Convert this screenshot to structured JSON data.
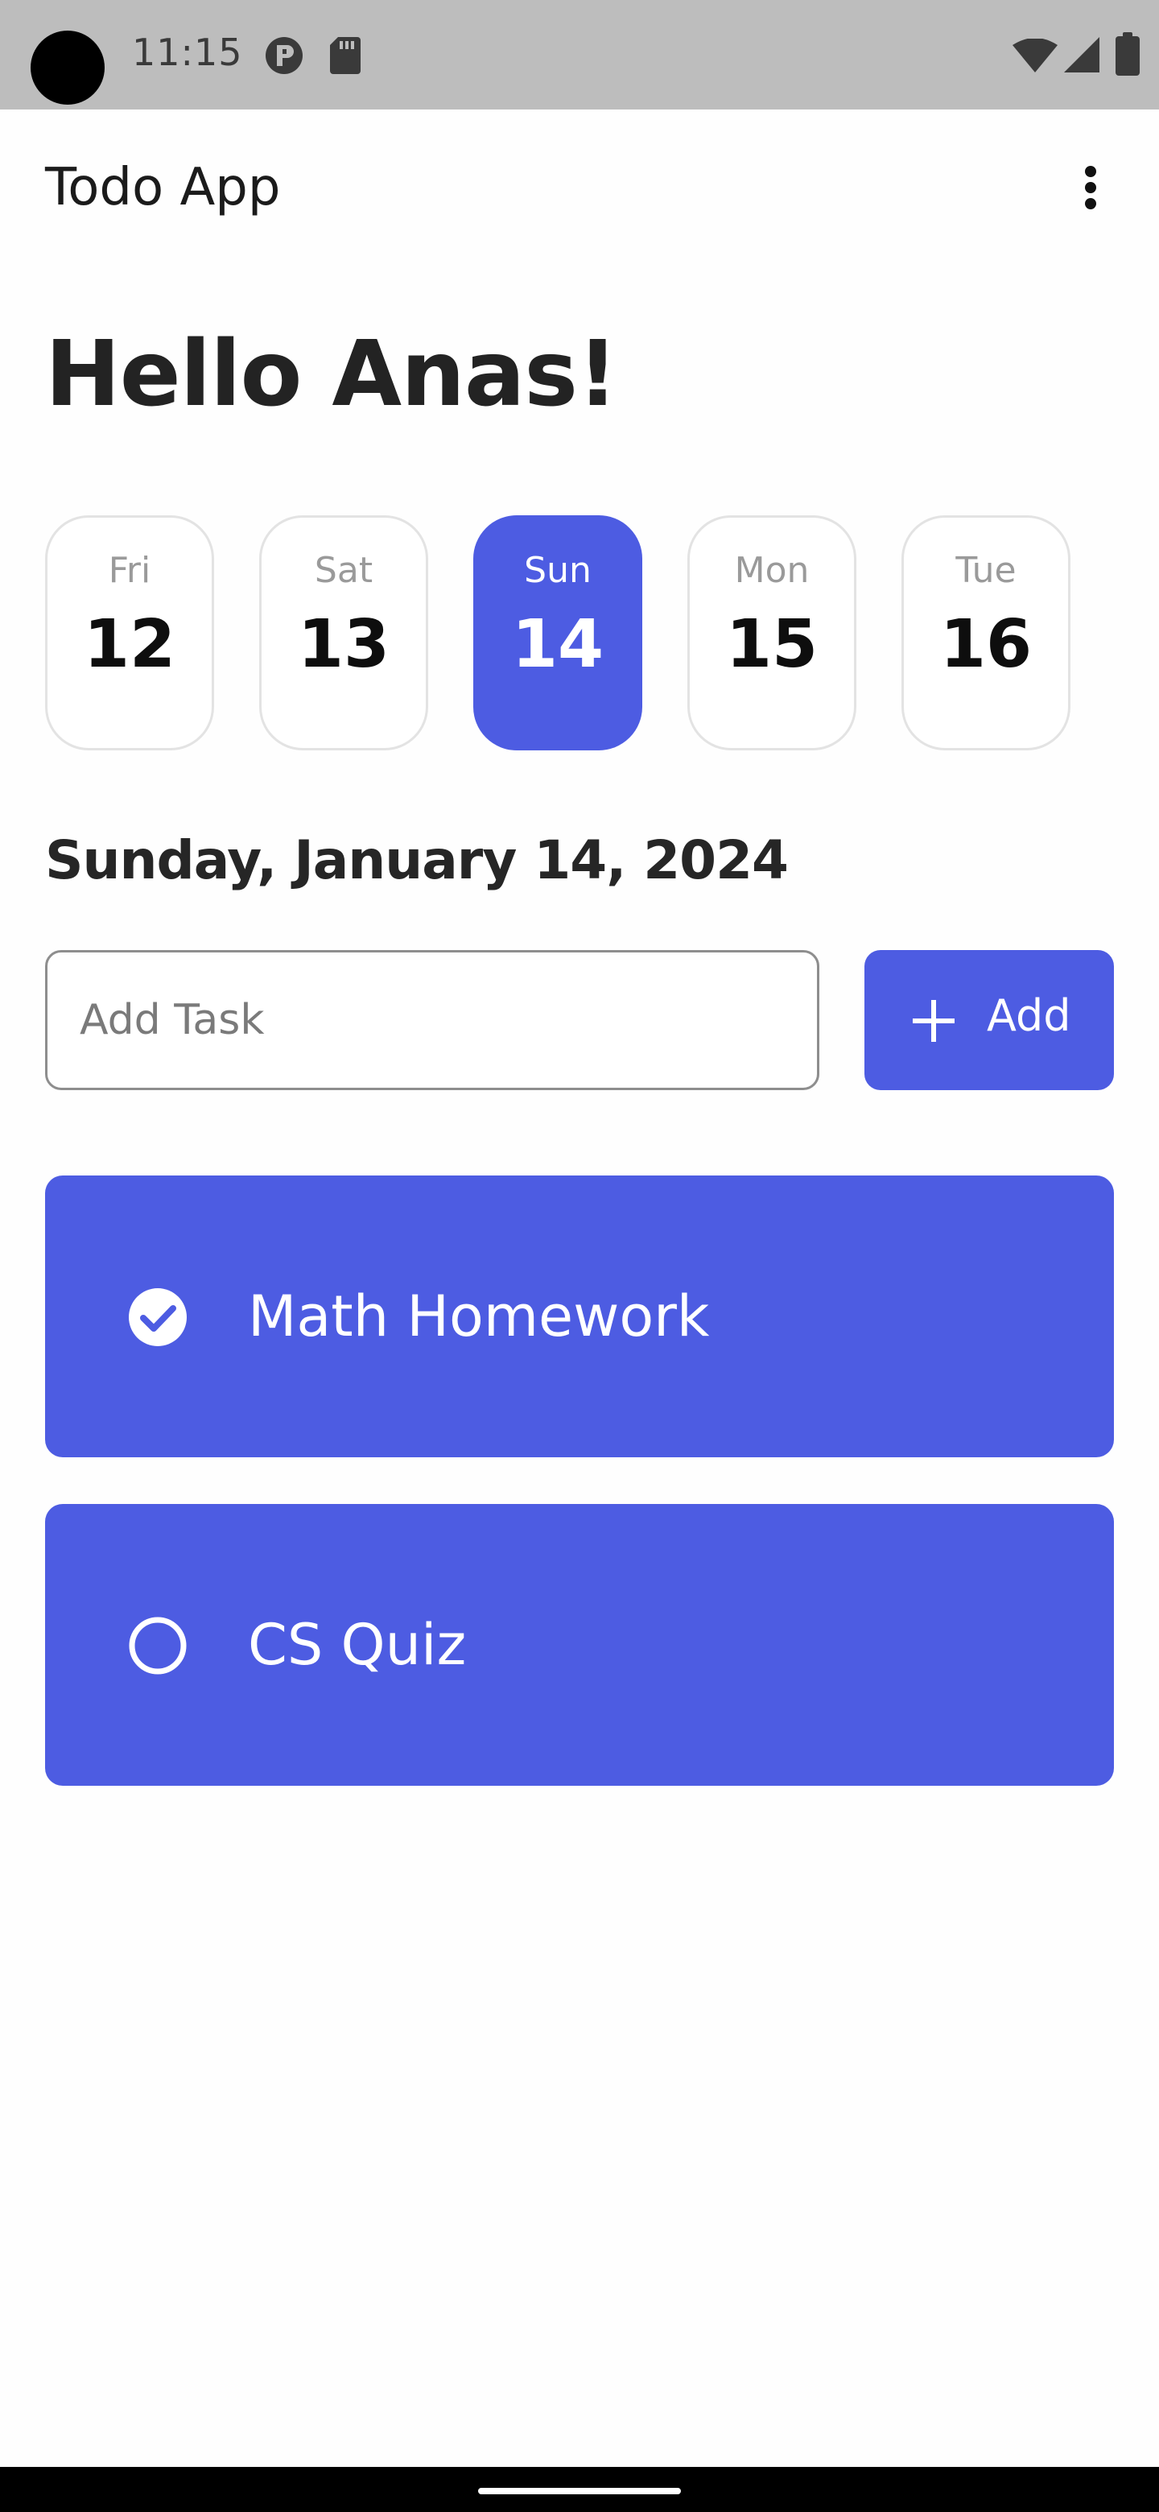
{
  "status_bar": {
    "time": "11:15",
    "icons": [
      "camera-cutout",
      "notification-p-icon",
      "sd-card-icon",
      "wifi-icon",
      "signal-icon",
      "battery-icon"
    ]
  },
  "app_bar": {
    "title": "Todo App",
    "menu_icon": "more-vert-icon"
  },
  "greeting": "Hello Anas!",
  "days": [
    {
      "name": "Fri",
      "num": "12",
      "selected": false
    },
    {
      "name": "Sat",
      "num": "13",
      "selected": false
    },
    {
      "name": "Sun",
      "num": "14",
      "selected": true
    },
    {
      "name": "Mon",
      "num": "15",
      "selected": false
    },
    {
      "name": "Tue",
      "num": "16",
      "selected": false
    }
  ],
  "selected_date": "Sunday, January 14, 2024",
  "add_task": {
    "placeholder": "Add Task",
    "value": "",
    "button_label": "Add",
    "button_icon": "plus-icon"
  },
  "tasks": [
    {
      "title": "Math Homework",
      "done": true
    },
    {
      "title": "CS Quiz",
      "done": false
    }
  ],
  "colors": {
    "accent": "#4D5CE2",
    "status_bar": "#BDBDBD",
    "card_border": "#E3E3E3",
    "text_primary": "#1F1F1F"
  }
}
